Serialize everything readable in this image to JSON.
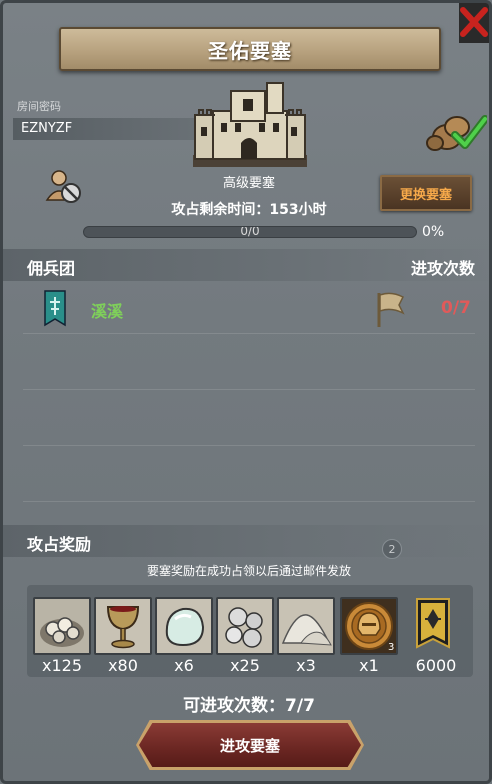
{
  "header": {
    "title": "圣佑要塞",
    "close_icon": "close-x-icon"
  },
  "room": {
    "label": "房间密码",
    "code": "EZNYZF"
  },
  "fortress": {
    "level_name": "高级要塞",
    "change_button": "更换要塞",
    "time_remaining_label": "攻占剩余时间：153小时",
    "progress_text": "0/0",
    "progress_percent_text": "0%",
    "progress_value": 0
  },
  "mercenary": {
    "section_title": "佣兵团",
    "attack_count_title": "进攻次数",
    "entries": [
      {
        "name": "溪溪",
        "attack_count": "0/7"
      }
    ]
  },
  "rewards": {
    "section_title": "攻占奖励",
    "help_badge": "2",
    "note": "要塞奖励在成功占领以后通过邮件发放",
    "items": [
      {
        "icon": "ore-pile-icon",
        "qty": "x125"
      },
      {
        "icon": "goblet-icon",
        "qty": "x80"
      },
      {
        "icon": "gem-stone-icon",
        "qty": "x6"
      },
      {
        "icon": "silver-orbs-icon",
        "qty": "x25"
      },
      {
        "icon": "powder-pile-icon",
        "qty": "x3"
      },
      {
        "icon": "helmet-medal-icon",
        "qty": "x1",
        "badge": "3"
      },
      {
        "icon": "guild-banner-icon",
        "qty": "6000"
      }
    ]
  },
  "footer": {
    "available_attacks": "可进攻次数：7/7",
    "attack_button": "进攻要塞"
  },
  "colors": {
    "panel": "#737a7f",
    "title_banner": "#b8a27f",
    "merc_name": "#7fd05a",
    "attack_count": "#e05a5a",
    "change_btn_text": "#f6a94a",
    "attack_btn": "#6a2622"
  }
}
